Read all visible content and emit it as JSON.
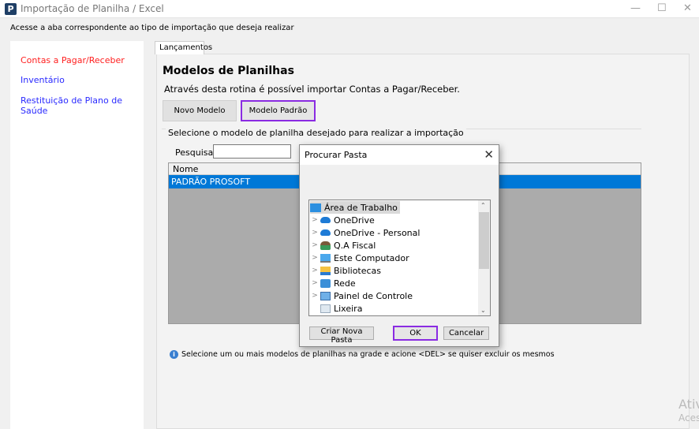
{
  "window": {
    "title": "Importação de Planilha / Excel",
    "logo": "P"
  },
  "instruction": "Acesse a aba correspondente ao tipo de importação que deseja realizar",
  "sidebar": {
    "items": [
      {
        "label": "Contas a Pagar/Receber",
        "color": "#ff2020"
      },
      {
        "label": "Inventário",
        "color": "#2a2aff"
      },
      {
        "label": "Restituição de Plano de Saúde",
        "color": "#2a2aff"
      }
    ]
  },
  "tabs": [
    {
      "label": "Lançamentos"
    }
  ],
  "main": {
    "title": "Modelos de Planilhas",
    "subtitle": "Através desta rotina é possível importar Contas a Pagar/Receber.",
    "new_model_label": "Novo Modelo",
    "default_model_label": "Modelo Padrão",
    "group_label": "Selecione o modelo de planilha desejado para realizar a importação",
    "search_label": "Pesquisar",
    "search_value": "",
    "grid": {
      "columns": [
        "Nome"
      ],
      "rows": [
        "PADRÃO PROSOFT"
      ]
    },
    "info": "Selecione um ou mais modelos de planilhas na grade e acione <DEL> se quiser excluir os mesmos"
  },
  "dialog": {
    "title": "Procurar Pasta",
    "tree": [
      {
        "label": "Área de Trabalho",
        "icon": "desktop-icon",
        "expandable": false
      },
      {
        "label": "OneDrive",
        "icon": "cloud-icon",
        "expandable": true
      },
      {
        "label": "OneDrive - Personal",
        "icon": "cloud-icon",
        "expandable": true
      },
      {
        "label": "Q.A Fiscal",
        "icon": "user-icon",
        "expandable": true
      },
      {
        "label": "Este Computador",
        "icon": "computer-icon",
        "expandable": true
      },
      {
        "label": "Bibliotecas",
        "icon": "library-icon",
        "expandable": true
      },
      {
        "label": "Rede",
        "icon": "network-icon",
        "expandable": true
      },
      {
        "label": "Painel de Controle",
        "icon": "control-panel-icon",
        "expandable": true
      },
      {
        "label": "Lixeira",
        "icon": "recycle-bin-icon",
        "expandable": false
      }
    ],
    "new_folder_label": "Criar Nova Pasta",
    "ok_label": "OK",
    "cancel_label": "Cancelar"
  },
  "watermark": {
    "line1": "Ativ",
    "line2": "Aces"
  }
}
